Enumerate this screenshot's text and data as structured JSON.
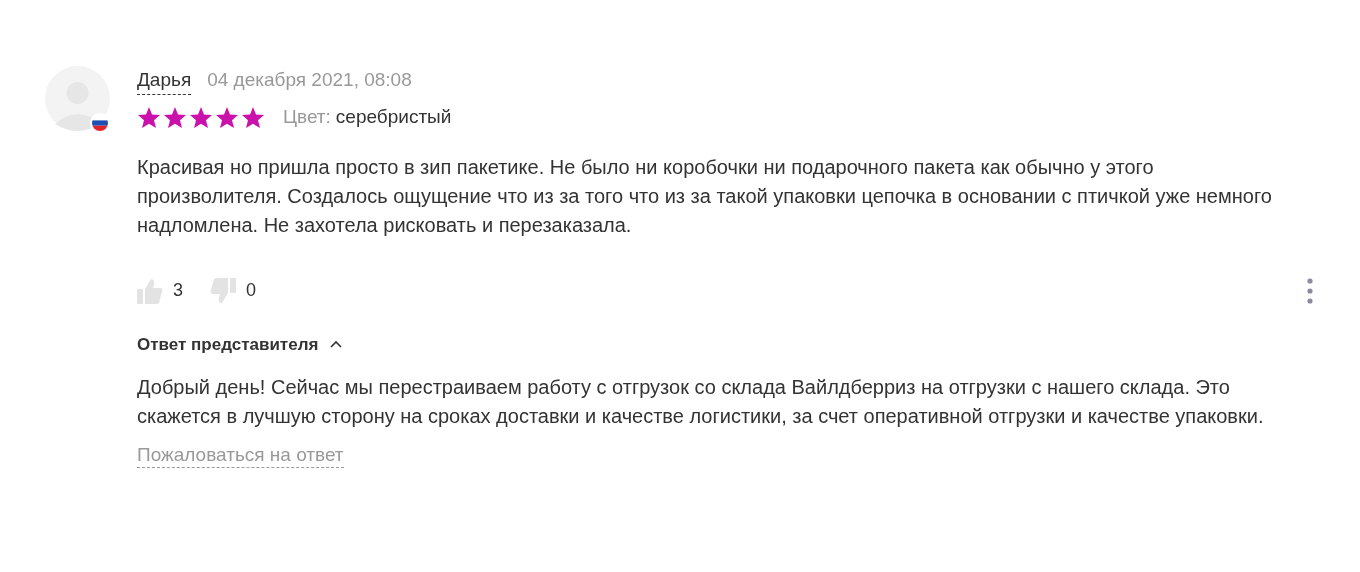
{
  "review": {
    "author": "Дарья",
    "date": "04 декабря 2021, 08:08",
    "stars": 5,
    "attribute_label": "Цвет:",
    "attribute_value": "серебристый",
    "text": "Красивая но пришла просто в зип пакетике. Не было ни коробочки ни подарочного пакета как обычно у этого произволителя. Создалось ощущение что из за того что из за такой упаковки цепочка в основании с птичкой уже немного надломлена. Не захотела рисковать и перезаказала.",
    "likes": "3",
    "dislikes": "0"
  },
  "answer": {
    "title": "Ответ представителя",
    "expanded": true,
    "text": "Добрый день! Сейчас мы перестраиваем работу с отгрузок со склада Вайлдберриз на отгрузки с нашего склада. Это скажется в лучшую сторону на сроках доставки и качестве логистики, за счет оперативной отгрузки и качестве упаковки.",
    "complain_link": "Пожаловаться на ответ"
  }
}
